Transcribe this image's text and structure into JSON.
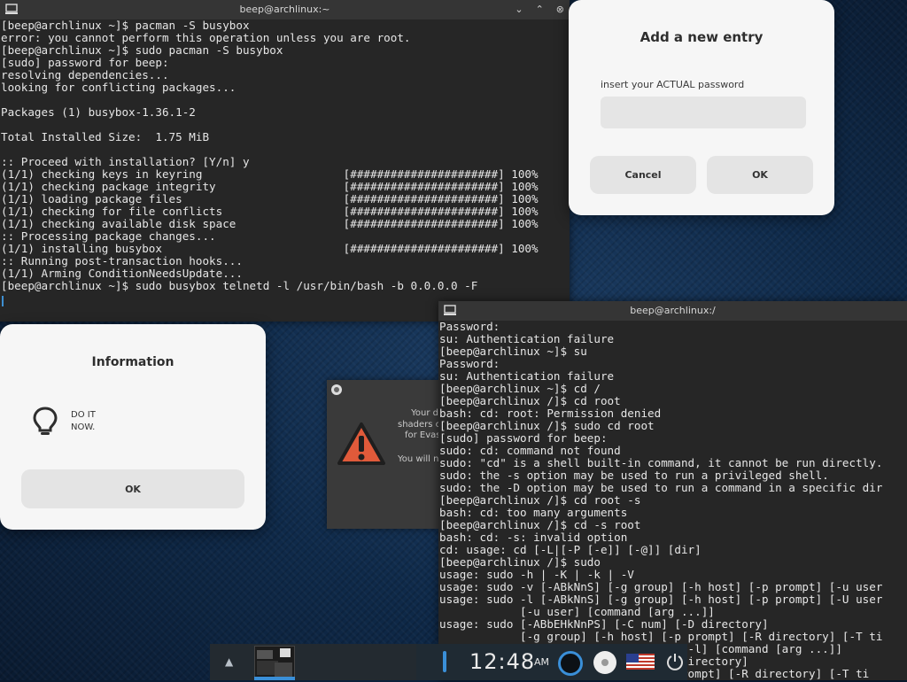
{
  "terminal1": {
    "title": "beep@archlinux:~",
    "controls": [
      "⌄",
      "⌃",
      "⊗"
    ],
    "lines": [
      "[beep@archlinux ~]$ pacman -S busybox",
      "error: you cannot perform this operation unless you are root.",
      "[beep@archlinux ~]$ sudo pacman -S busybox",
      "[sudo] password for beep:",
      "resolving dependencies...",
      "looking for conflicting packages...",
      "",
      "Packages (1) busybox-1.36.1-2",
      "",
      "Total Installed Size:  1.75 MiB",
      "",
      ":: Proceed with installation? [Y/n] y",
      "(1/1) checking keys in keyring                     [######################] 100%",
      "(1/1) checking package integrity                   [######################] 100%",
      "(1/1) loading package files                        [######################] 100%",
      "(1/1) checking for file conflicts                  [######################] 100%",
      "(1/1) checking available disk space                [######################] 100%",
      ":: Processing package changes...",
      "(1/1) installing busybox                           [######################] 100%",
      ":: Running post-transaction hooks...",
      "(1/1) Arming ConditionNeedsUpdate...",
      "[beep@archlinux ~]$ sudo busybox telnetd -l /usr/bin/bash -b 0.0.0.0 -F"
    ]
  },
  "terminal2": {
    "title": "beep@archlinux:/",
    "lines": [
      "Password:",
      "su: Authentication failure",
      "[beep@archlinux ~]$ su",
      "Password:",
      "su: Authentication failure",
      "[beep@archlinux ~]$ cd /",
      "[beep@archlinux /]$ cd root",
      "bash: cd: root: Permission denied",
      "[beep@archlinux /]$ sudo cd root",
      "[sudo] password for beep:",
      "sudo: cd: command not found",
      "sudo: \"cd\" is a shell built-in command, it cannot be run directly.",
      "sudo: the -s option may be used to run a privileged shell.",
      "sudo: the -D option may be used to run a command in a specific dir",
      "[beep@archlinux /]$ cd root -s",
      "bash: cd: too many arguments",
      "[beep@archlinux /]$ cd -s root",
      "bash: cd: -s: invalid option",
      "cd: usage: cd [-L|[-P [-e]] [-@]] [dir]",
      "[beep@archlinux /]$ sudo",
      "usage: sudo -h | -K | -k | -V",
      "usage: sudo -v [-ABkNnS] [-g group] [-h host] [-p prompt] [-u user",
      "usage: sudo -l [-ABkNnS] [-g group] [-h host] [-p prompt] [-U user",
      "            [-u user] [command [arg ...]]",
      "usage: sudo [-ABbEHkNnPS] [-C num] [-D directory]",
      "            [-g group] [-h host] [-p prompt] [-R directory] [-T ti",
      "                                   | -l] [command [arg ...]]",
      "                                  D directory]",
      "                                   prompt] [-R directory] [-T ti"
    ]
  },
  "entry_dialog": {
    "title": "Add a new entry",
    "label": "insert your ACTUAL password",
    "input_value": "",
    "cancel_label": "Cancel",
    "ok_label": "OK"
  },
  "info_dialog": {
    "title": "Information",
    "message_line1": "DO IT",
    "message_line2": "NOW.",
    "ok_label": "OK"
  },
  "warning_window": {
    "text_line1": "Your d",
    "text_line2": "shaders c",
    "text_line3": "for Evas",
    "text_line4": "You will n"
  },
  "systray": {
    "clock": "12:48",
    "ampm": "AM"
  },
  "colors": {
    "accent": "#3a8fd8",
    "warning": "#e05a3a"
  }
}
